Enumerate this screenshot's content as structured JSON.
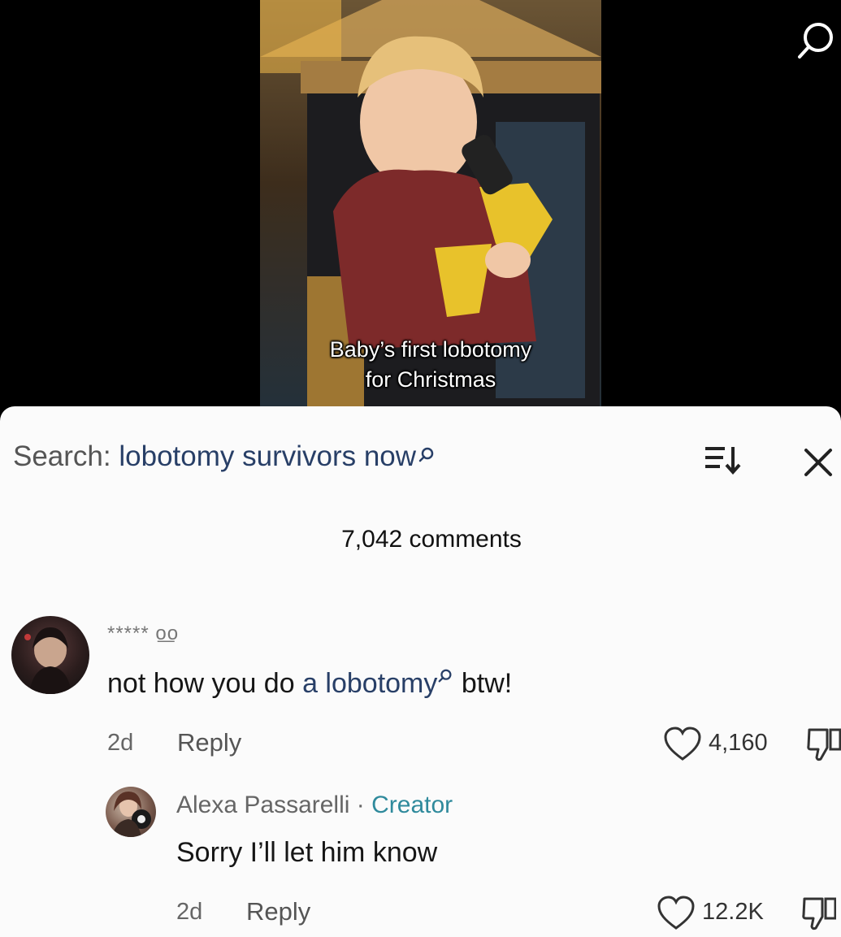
{
  "video": {
    "caption_line1": "Baby’s first lobotomy",
    "caption_line2": "for Christmas"
  },
  "search": {
    "prefix": "Search:",
    "term": "lobotomy survivors now"
  },
  "comments_count": "7,042 comments",
  "comments": [
    {
      "username": "*****",
      "username_decoration": "o͟o",
      "text_before": "not how you do ",
      "link_text": "a lobotomy",
      "text_after": " btw!",
      "date": "2d",
      "reply_label": "Reply",
      "likes": "4,160"
    },
    {
      "username": "Alexa Passarelli",
      "separator": " · ",
      "badge": "Creator",
      "text": "Sorry I’ll let him know",
      "date": "2d",
      "reply_label": "Reply",
      "likes": "12.2K"
    }
  ],
  "icons": {
    "top": "search-icon",
    "sort": "sort-icon",
    "close": "close-icon",
    "like": "heart-icon",
    "dislike": "thumbs-down-icon"
  },
  "colors": {
    "link": "#283f67",
    "creator": "#2f8a9c",
    "sheet_bg": "#fbfbfb"
  }
}
